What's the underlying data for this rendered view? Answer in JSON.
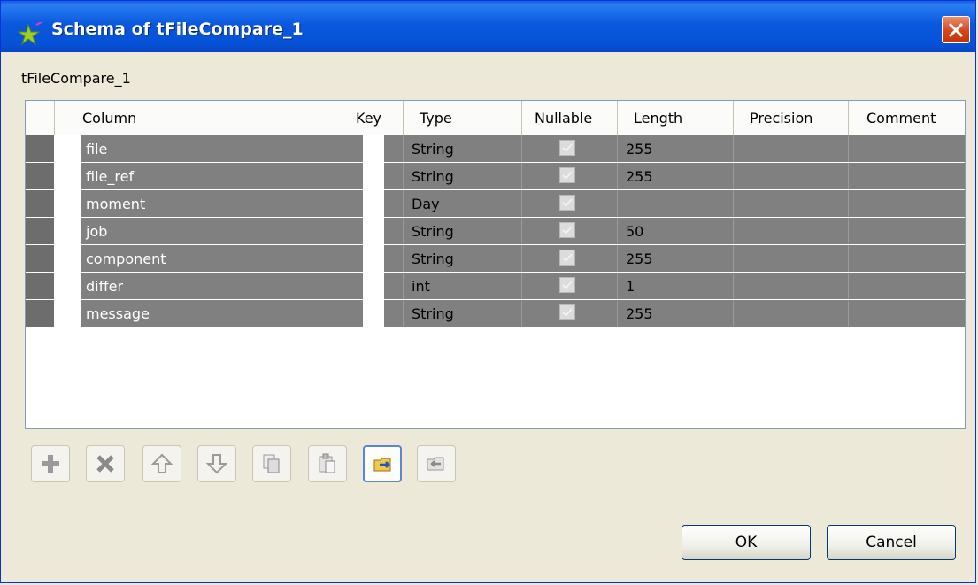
{
  "window": {
    "title": "Schema of tFileCompare_1"
  },
  "component_label": "tFileCompare_1",
  "table": {
    "headers": [
      "Column",
      "Key",
      "Type",
      "Nullable",
      "Length",
      "Precision",
      "Comment"
    ],
    "rows": [
      {
        "column": "file",
        "type": "String",
        "length": "255"
      },
      {
        "column": "file_ref",
        "type": "String",
        "length": "255"
      },
      {
        "column": "moment",
        "type": "Day",
        "length": ""
      },
      {
        "column": "job",
        "type": "String",
        "length": "50"
      },
      {
        "column": "component",
        "type": "String",
        "length": "255"
      },
      {
        "column": "differ",
        "type": "int",
        "length": "1"
      },
      {
        "column": "message",
        "type": "String",
        "length": "255"
      }
    ]
  },
  "toolbar": {
    "icons": [
      "add-icon",
      "remove-icon",
      "move-up-icon",
      "move-down-icon",
      "copy-icon",
      "paste-icon",
      "export-schema-icon",
      "import-schema-icon"
    ]
  },
  "buttons": {
    "ok": "OK",
    "cancel": "Cancel"
  },
  "colors": {
    "titlebar": "#0a58de",
    "row_selected": "#808080",
    "background": "#ece9d8"
  }
}
